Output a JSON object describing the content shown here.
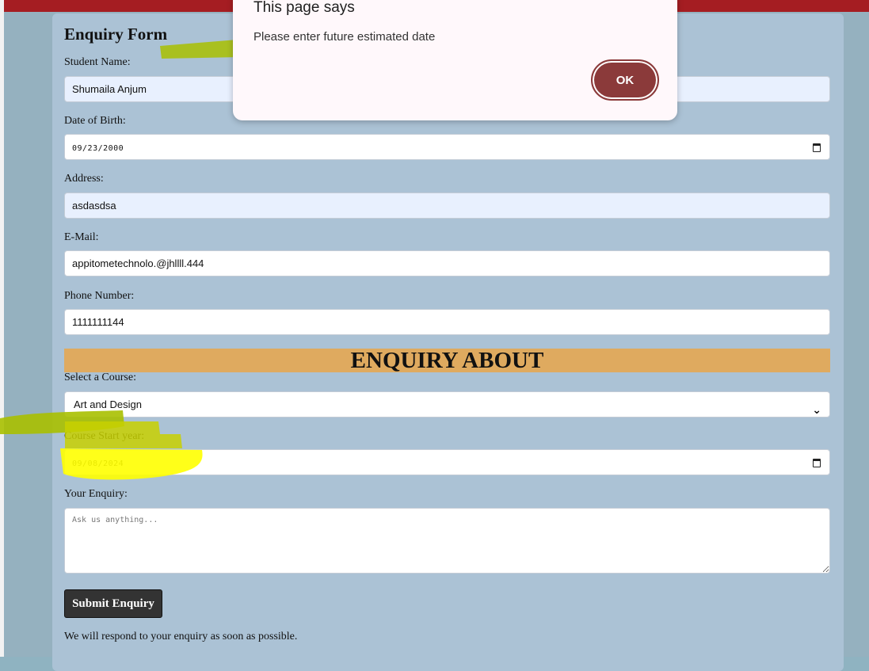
{
  "form": {
    "title": "Enquiry Form",
    "student_name": {
      "label": "Student Name:",
      "value": "Shumaila Anjum"
    },
    "dob": {
      "label": "Date of Birth:",
      "value": "09/23/2000"
    },
    "address": {
      "label": "Address:",
      "value": "asdasdsa"
    },
    "email": {
      "label": "E-Mail:",
      "value": "appitometechnolo.@jhllll.444"
    },
    "phone": {
      "label": "Phone Number:",
      "value": "1111111144"
    },
    "section_banner": "ENQUIRY ABOUT",
    "course": {
      "label": "Select a Course:",
      "value": "Art and Design"
    },
    "start_year": {
      "label": "Course Start year:",
      "value": "09/08/2024"
    },
    "enquiry": {
      "label": "Your Enquiry:",
      "placeholder": "Ask us anything..."
    },
    "submit_label": "Submit Enquiry",
    "note": "We will respond to your enquiry as soon as possible."
  },
  "dialog": {
    "title": "This page says",
    "message": "Please enter future estimated date",
    "ok_label": "OK"
  },
  "colors": {
    "top_bar": "#a51d22",
    "panel": "#abc2d5",
    "banner": "#dfaa5f",
    "ok_button": "#8b3a3a",
    "highlight": "#ffff00"
  }
}
